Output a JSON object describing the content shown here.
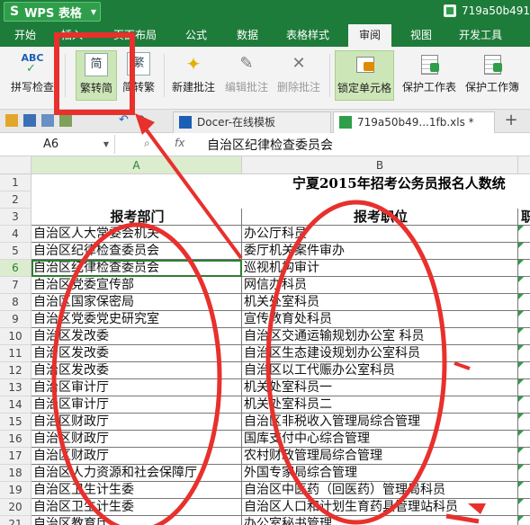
{
  "app": {
    "name": "WPS 表格",
    "doc_title": "719a50b491e",
    "logo_letter": "S"
  },
  "menu": {
    "tabs": [
      "开始",
      "插入",
      "页面布局",
      "公式",
      "数据",
      "表格样式",
      "审阅",
      "视图",
      "开发工具"
    ],
    "active": "审阅"
  },
  "ribbon": {
    "spell_check": "拼写检查",
    "spell_icon_text": "ABC",
    "to_simplified": "繁转简",
    "to_simplified_icon": "简",
    "to_traditional": "简转繁",
    "to_traditional_icon": "繁",
    "new_comment": "新建批注",
    "edit_comment": "编辑批注",
    "delete_comment": "删除批注",
    "lock_cell": "锁定单元格",
    "protect_sheet": "保护工作表",
    "protect_book": "保护工作簿"
  },
  "doc_tabs": [
    {
      "label": "Docer-在线模板"
    },
    {
      "label": "719a50b49...1fb.xls *"
    }
  ],
  "formula_bar": {
    "cell_ref": "A6",
    "fx": "fx",
    "value": "自治区纪律检查委员会"
  },
  "grid": {
    "columns": [
      "A",
      "B"
    ],
    "title": "宁夏2015年招考公务员报名人数统",
    "header_a": "报考部门",
    "header_b": "报考职位",
    "header_c": "职",
    "rows": [
      {
        "n": "1",
        "a": "",
        "b": ""
      },
      {
        "n": "2",
        "a": "",
        "b": ""
      },
      {
        "n": "3",
        "a": "报考部门",
        "b": "报考职位"
      },
      {
        "n": "4",
        "a": "自治区人大常委会机关",
        "b": "办公厅科员"
      },
      {
        "n": "5",
        "a": "自治区纪律检查委员会",
        "b": "委厅机关案件审办"
      },
      {
        "n": "6",
        "a": "自治区纪律检查委员会",
        "b": "巡视机构审计"
      },
      {
        "n": "7",
        "a": "自治区党委宣传部",
        "b": "网信办科员"
      },
      {
        "n": "8",
        "a": "自治区国家保密局",
        "b": "机关处室科员"
      },
      {
        "n": "9",
        "a": "自治区党委党史研究室",
        "b": "宣传教育处科员"
      },
      {
        "n": "10",
        "a": "自治区发改委",
        "b": "自治区交通运输规划办公室 科员"
      },
      {
        "n": "11",
        "a": "自治区发改委",
        "b": "自治区生态建设规划办公室科员"
      },
      {
        "n": "12",
        "a": "自治区发改委",
        "b": "自治区以工代赈办公室科员"
      },
      {
        "n": "13",
        "a": "自治区审计厅",
        "b": "机关处室科员一"
      },
      {
        "n": "14",
        "a": "自治区审计厅",
        "b": "机关处室科员二"
      },
      {
        "n": "15",
        "a": "自治区财政厅",
        "b": "自治区非税收入管理局综合管理"
      },
      {
        "n": "16",
        "a": "自治区财政厅",
        "b": "国库支付中心综合管理"
      },
      {
        "n": "17",
        "a": "自治区财政厅",
        "b": "农村财政管理局综合管理"
      },
      {
        "n": "18",
        "a": "自治区人力资源和社会保障厅",
        "b": "外国专家局综合管理"
      },
      {
        "n": "19",
        "a": "自治区卫生计生委",
        "b": "自治区中医药（回医药）管理局科员"
      },
      {
        "n": "20",
        "a": "自治区卫生计生委",
        "b": "自治区人口和计划生育药具管理站科员"
      },
      {
        "n": "21",
        "a": "自治区教育厅",
        "b": "办公室秘书管理"
      }
    ],
    "selected_row": "6"
  },
  "colors": {
    "titlebar": "#1e7c3a",
    "annotation": "#e8302c",
    "selection": "#2f7d32"
  }
}
